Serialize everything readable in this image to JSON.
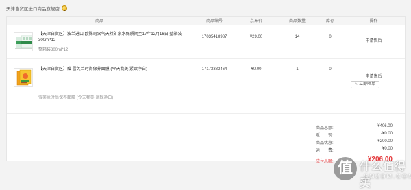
{
  "store": {
    "name": "天津自贸区进口商品旗舰店"
  },
  "table": {
    "headers": [
      "商品",
      "商品编号",
      "京东价",
      "商品数量",
      "库存",
      "操作"
    ]
  },
  "items": [
    {
      "title": "【天津自贸区】波兰进口 欧殊司含气天然矿泉水保质期至17年12月16日 整箱装300ml*12",
      "spec": "整箱装300ml*12",
      "code": "17035418987",
      "price": "¥29.00",
      "qty": "14",
      "stock": "0",
      "action": "申请售后"
    },
    {
      "title": "【天津自贸区】赠 雪芙兰时尚保养面膜 (今天我美,紧致净白)",
      "spec": "雪芙兰时尚保养面膜 (今天我美,紧致净白)",
      "code": "17173382464",
      "price": "¥0.00",
      "qty": "1",
      "stock": "0",
      "action": "申请售后",
      "review": "立即晒单"
    }
  ],
  "summary": [
    {
      "label": "商品总额:",
      "value": "¥406.00"
    },
    {
      "label": "返　　现:",
      "value": "-¥0.00"
    },
    {
      "label": "商品优惠:",
      "value": "-¥200.00"
    },
    {
      "label": "运　　费:",
      "value": "¥0.00"
    }
  ],
  "total": {
    "label": "应付总额:",
    "value": "¥206.00"
  },
  "watermark": {
    "logo_char": "值",
    "text": "什么值得买",
    "sub": "SMZDM.COM"
  },
  "colors": {
    "accent": "#e4393c",
    "header_bg": "#f5f5f5",
    "page_bg": "#f3f3f3"
  }
}
